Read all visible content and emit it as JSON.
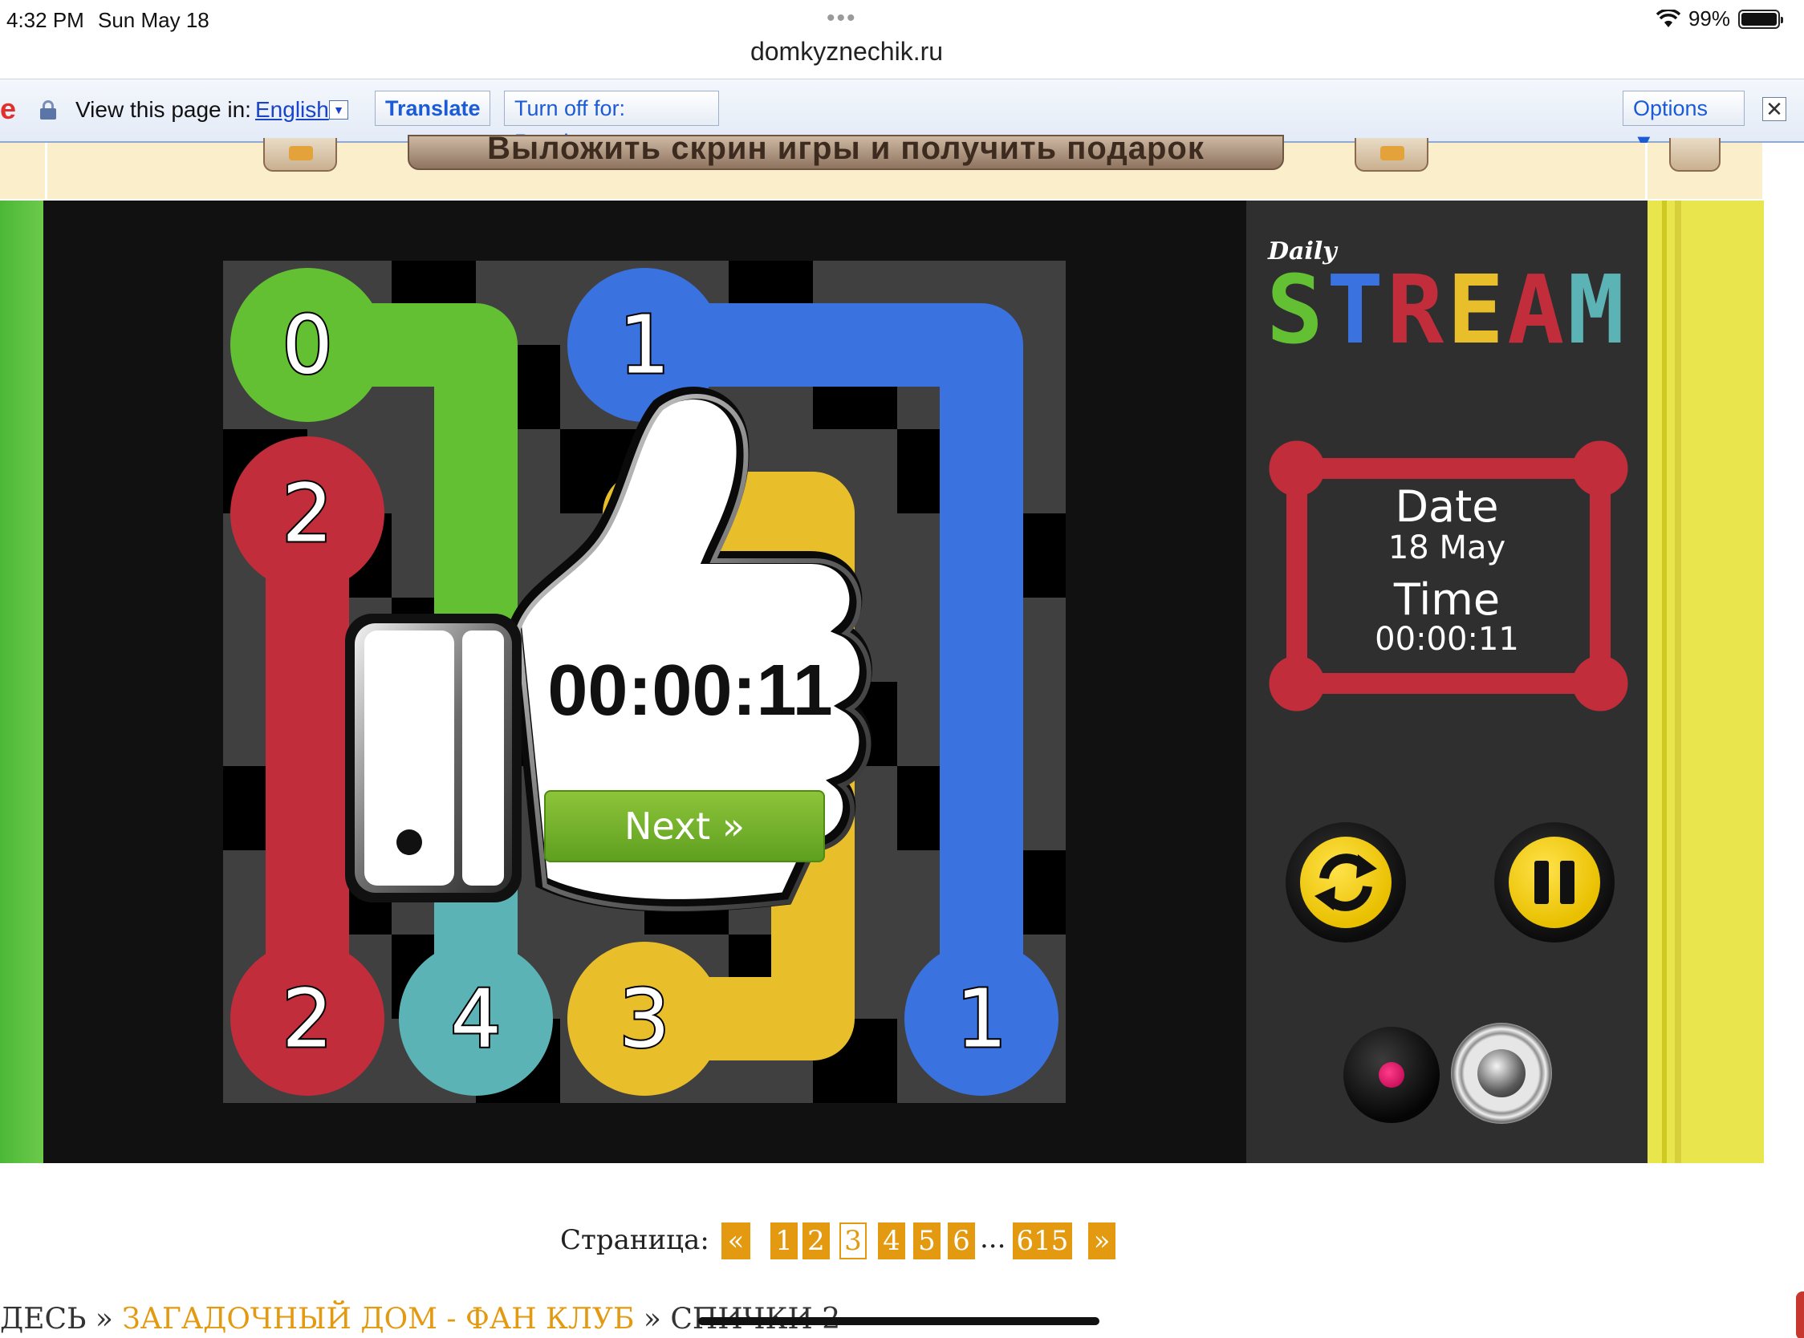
{
  "status_bar": {
    "time": "4:32 PM",
    "date": "Sun May 18",
    "dots": "•••",
    "battery": "99%"
  },
  "browser": {
    "url": "domkyznechik.ru"
  },
  "translate_bar": {
    "label": "View this page in:",
    "language": "English",
    "translate_button": "Translate",
    "turn_off_button": "Turn off for: Russian",
    "options_button": "Options ▼",
    "close": "✕"
  },
  "banner": {
    "text": "Выложить скрин игры и получить подарок"
  },
  "game": {
    "board_size": 5,
    "dots": [
      {
        "label": "0",
        "color": "#63c033",
        "row": 0,
        "col": 0
      },
      {
        "label": "1",
        "color": "#3a72e0",
        "row": 0,
        "col": 2
      },
      {
        "label": "1",
        "color": "#3a72e0",
        "row": 4,
        "col": 4
      },
      {
        "label": "2",
        "color": "#c12d3b",
        "row": 1,
        "col": 0
      },
      {
        "label": "2",
        "color": "#c12d3b",
        "row": 4,
        "col": 0
      },
      {
        "label": "3",
        "color": "#e9be2b",
        "row": 4,
        "col": 2
      },
      {
        "label": "4",
        "color": "#5cb3b5",
        "row": 4,
        "col": 1
      }
    ],
    "overlay": {
      "time": "00:00:11",
      "next_button": "Next »"
    }
  },
  "sidebar": {
    "logo_small": "Daily",
    "logo_letters": [
      {
        "ch": "S",
        "color": "#63c033"
      },
      {
        "ch": "T",
        "color": "#3a72e0"
      },
      {
        "ch": "R",
        "color": "#c12d3b"
      },
      {
        "ch": "E",
        "color": "#e9be2b"
      },
      {
        "ch": "A",
        "color": "#c12d3b"
      },
      {
        "ch": "M",
        "color": "#5cb3b5"
      }
    ],
    "date_label": "Date",
    "date_value": "18 May",
    "time_label": "Time",
    "time_value": "00:00:11",
    "frame_color": "#c12d3b"
  },
  "pagination": {
    "label": "Страница:",
    "prev": "«",
    "pages": [
      "1",
      "2",
      "3",
      "4",
      "5",
      "6"
    ],
    "current": "3",
    "ellipsis": "...",
    "last": "615",
    "next": "»"
  },
  "breadcrumb": {
    "prefix": "ДЕСЬ",
    "sep": "»",
    "link": "ЗАГАДОЧНЫЙ ДОМ - ФАН КЛУБ",
    "current": "СПИЧКИ 2"
  }
}
